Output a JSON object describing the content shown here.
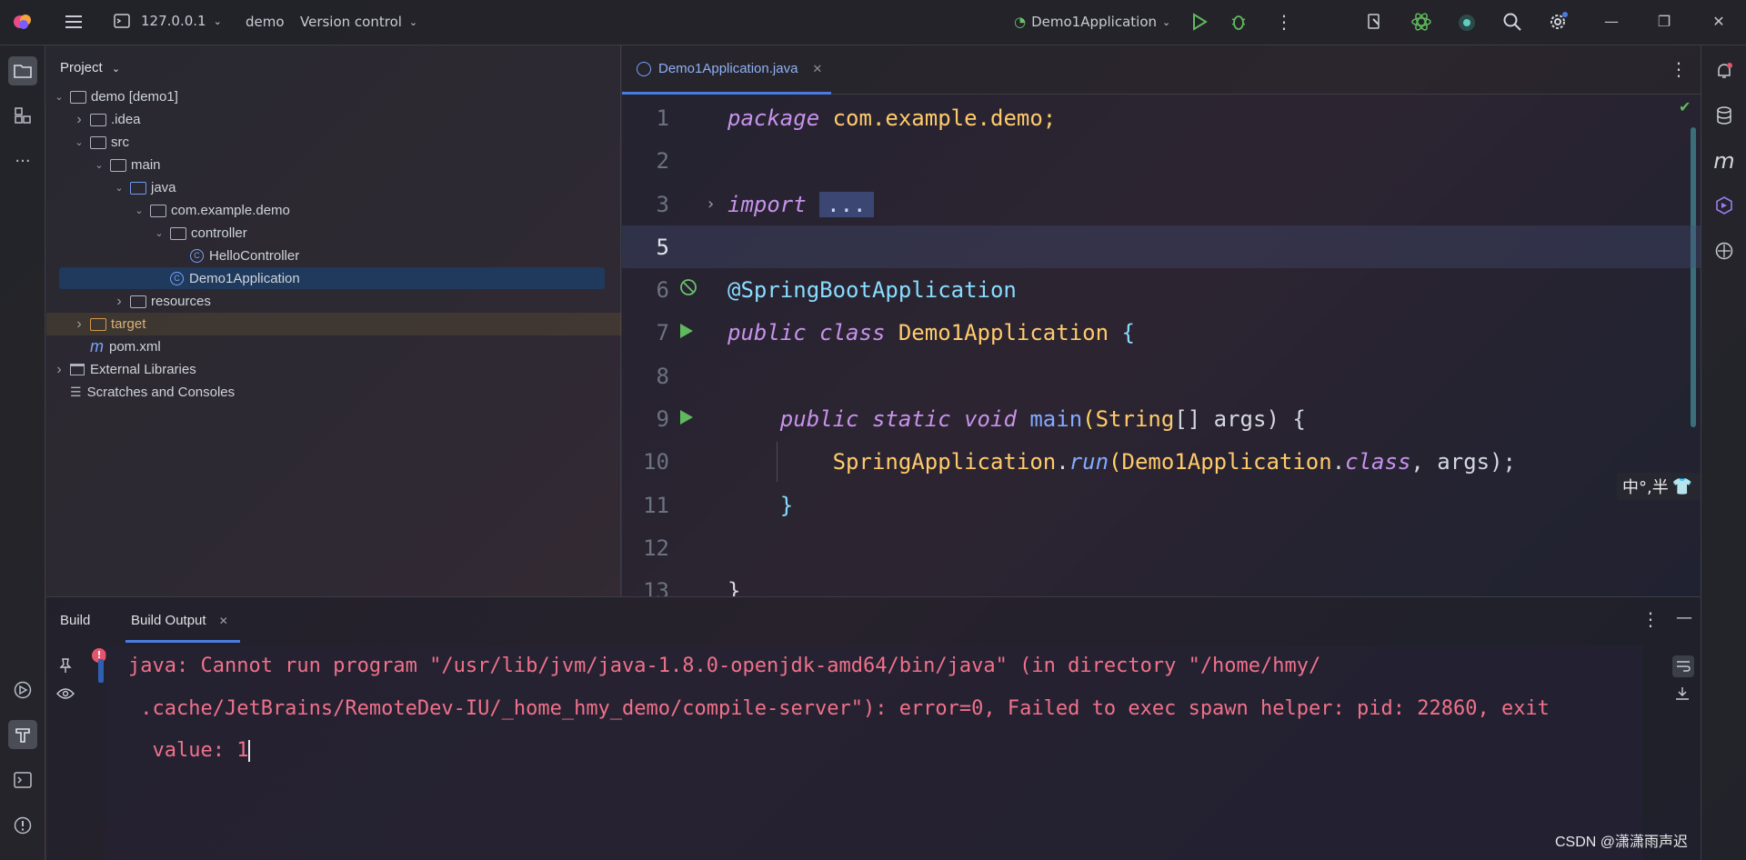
{
  "titlebar": {
    "host": "127.0.0.1",
    "project": "demo",
    "vcs": "Version control",
    "run_config": "Demo1Application"
  },
  "project_panel": {
    "title": "Project",
    "tree": [
      {
        "label": "demo [demo1]",
        "level": 0,
        "arrow": "down",
        "icon": "module-folder"
      },
      {
        "label": ".idea",
        "level": 1,
        "arrow": "right",
        "icon": "folder"
      },
      {
        "label": "src",
        "level": 1,
        "arrow": "down",
        "icon": "folder"
      },
      {
        "label": "main",
        "level": 2,
        "arrow": "down",
        "icon": "folder"
      },
      {
        "label": "java",
        "level": 3,
        "arrow": "down",
        "icon": "source-folder"
      },
      {
        "label": "com.example.demo",
        "level": 4,
        "arrow": "down",
        "icon": "package"
      },
      {
        "label": "controller",
        "level": 5,
        "arrow": "down",
        "icon": "package"
      },
      {
        "label": "HelloController",
        "level": 6,
        "arrow": "",
        "icon": "class"
      },
      {
        "label": "Demo1Application",
        "level": 5,
        "arrow": "",
        "icon": "spring-class"
      },
      {
        "label": "resources",
        "level": 3,
        "arrow": "right",
        "icon": "resources-folder"
      },
      {
        "label": "target",
        "level": 1,
        "arrow": "right",
        "icon": "excluded-folder"
      },
      {
        "label": "pom.xml",
        "level": 1,
        "arrow": "",
        "icon": "maven"
      },
      {
        "label": "External Libraries",
        "level": 0,
        "arrow": "right",
        "icon": "library"
      },
      {
        "label": "Scratches and Consoles",
        "level": 0,
        "arrow": "",
        "icon": "scratches"
      }
    ]
  },
  "editor": {
    "tab": "Demo1Application.java",
    "lines": [
      {
        "n": "1"
      },
      {
        "n": "2"
      },
      {
        "n": "3"
      },
      {
        "n": "5"
      },
      {
        "n": "6"
      },
      {
        "n": "7"
      },
      {
        "n": "8"
      },
      {
        "n": "9"
      },
      {
        "n": "10"
      },
      {
        "n": "11"
      },
      {
        "n": "12"
      },
      {
        "n": "13"
      }
    ],
    "tokens": {
      "package_kw": "package",
      "package_name": " com.example.demo;",
      "import_kw": "import",
      "import_fold": "...",
      "annotation": "@SpringBootApplication",
      "public": "public",
      "class_kw": "class",
      "class_name": "Demo1Application",
      "brace_open": " {",
      "indent1": "    ",
      "public2": "public",
      "static": "static",
      "void": "void",
      "main": "main",
      "paren_open": "(",
      "string_type": "String",
      "args_decl": "[] args) {",
      "indent2": "        ",
      "spring_app": "SpringApplication",
      "dot": ".",
      "run": "run",
      "run_paren": "(",
      "demo_cls": "Demo1Application",
      "dot2": ".",
      "class_lit": "class",
      "run_args": ", args);",
      "close_method": "    }",
      "close_class": "}"
    }
  },
  "ime": {
    "text": "中°,半"
  },
  "build": {
    "tab1": "Build",
    "tab2": "Build Output",
    "error_lines": [
      "java: Cannot run program \"/usr/lib/jvm/java-1.8.0-openjdk-amd64/bin/java\" (in directory \"/home/hmy/",
      " .cache/JetBrains/RemoteDev-IU/_home_hmy_demo/compile-server\"): error=0, Failed to exec spawn helper: pid: 22860, exit",
      "  value: 1"
    ]
  },
  "watermark": "CSDN @潇潇雨声迟"
}
